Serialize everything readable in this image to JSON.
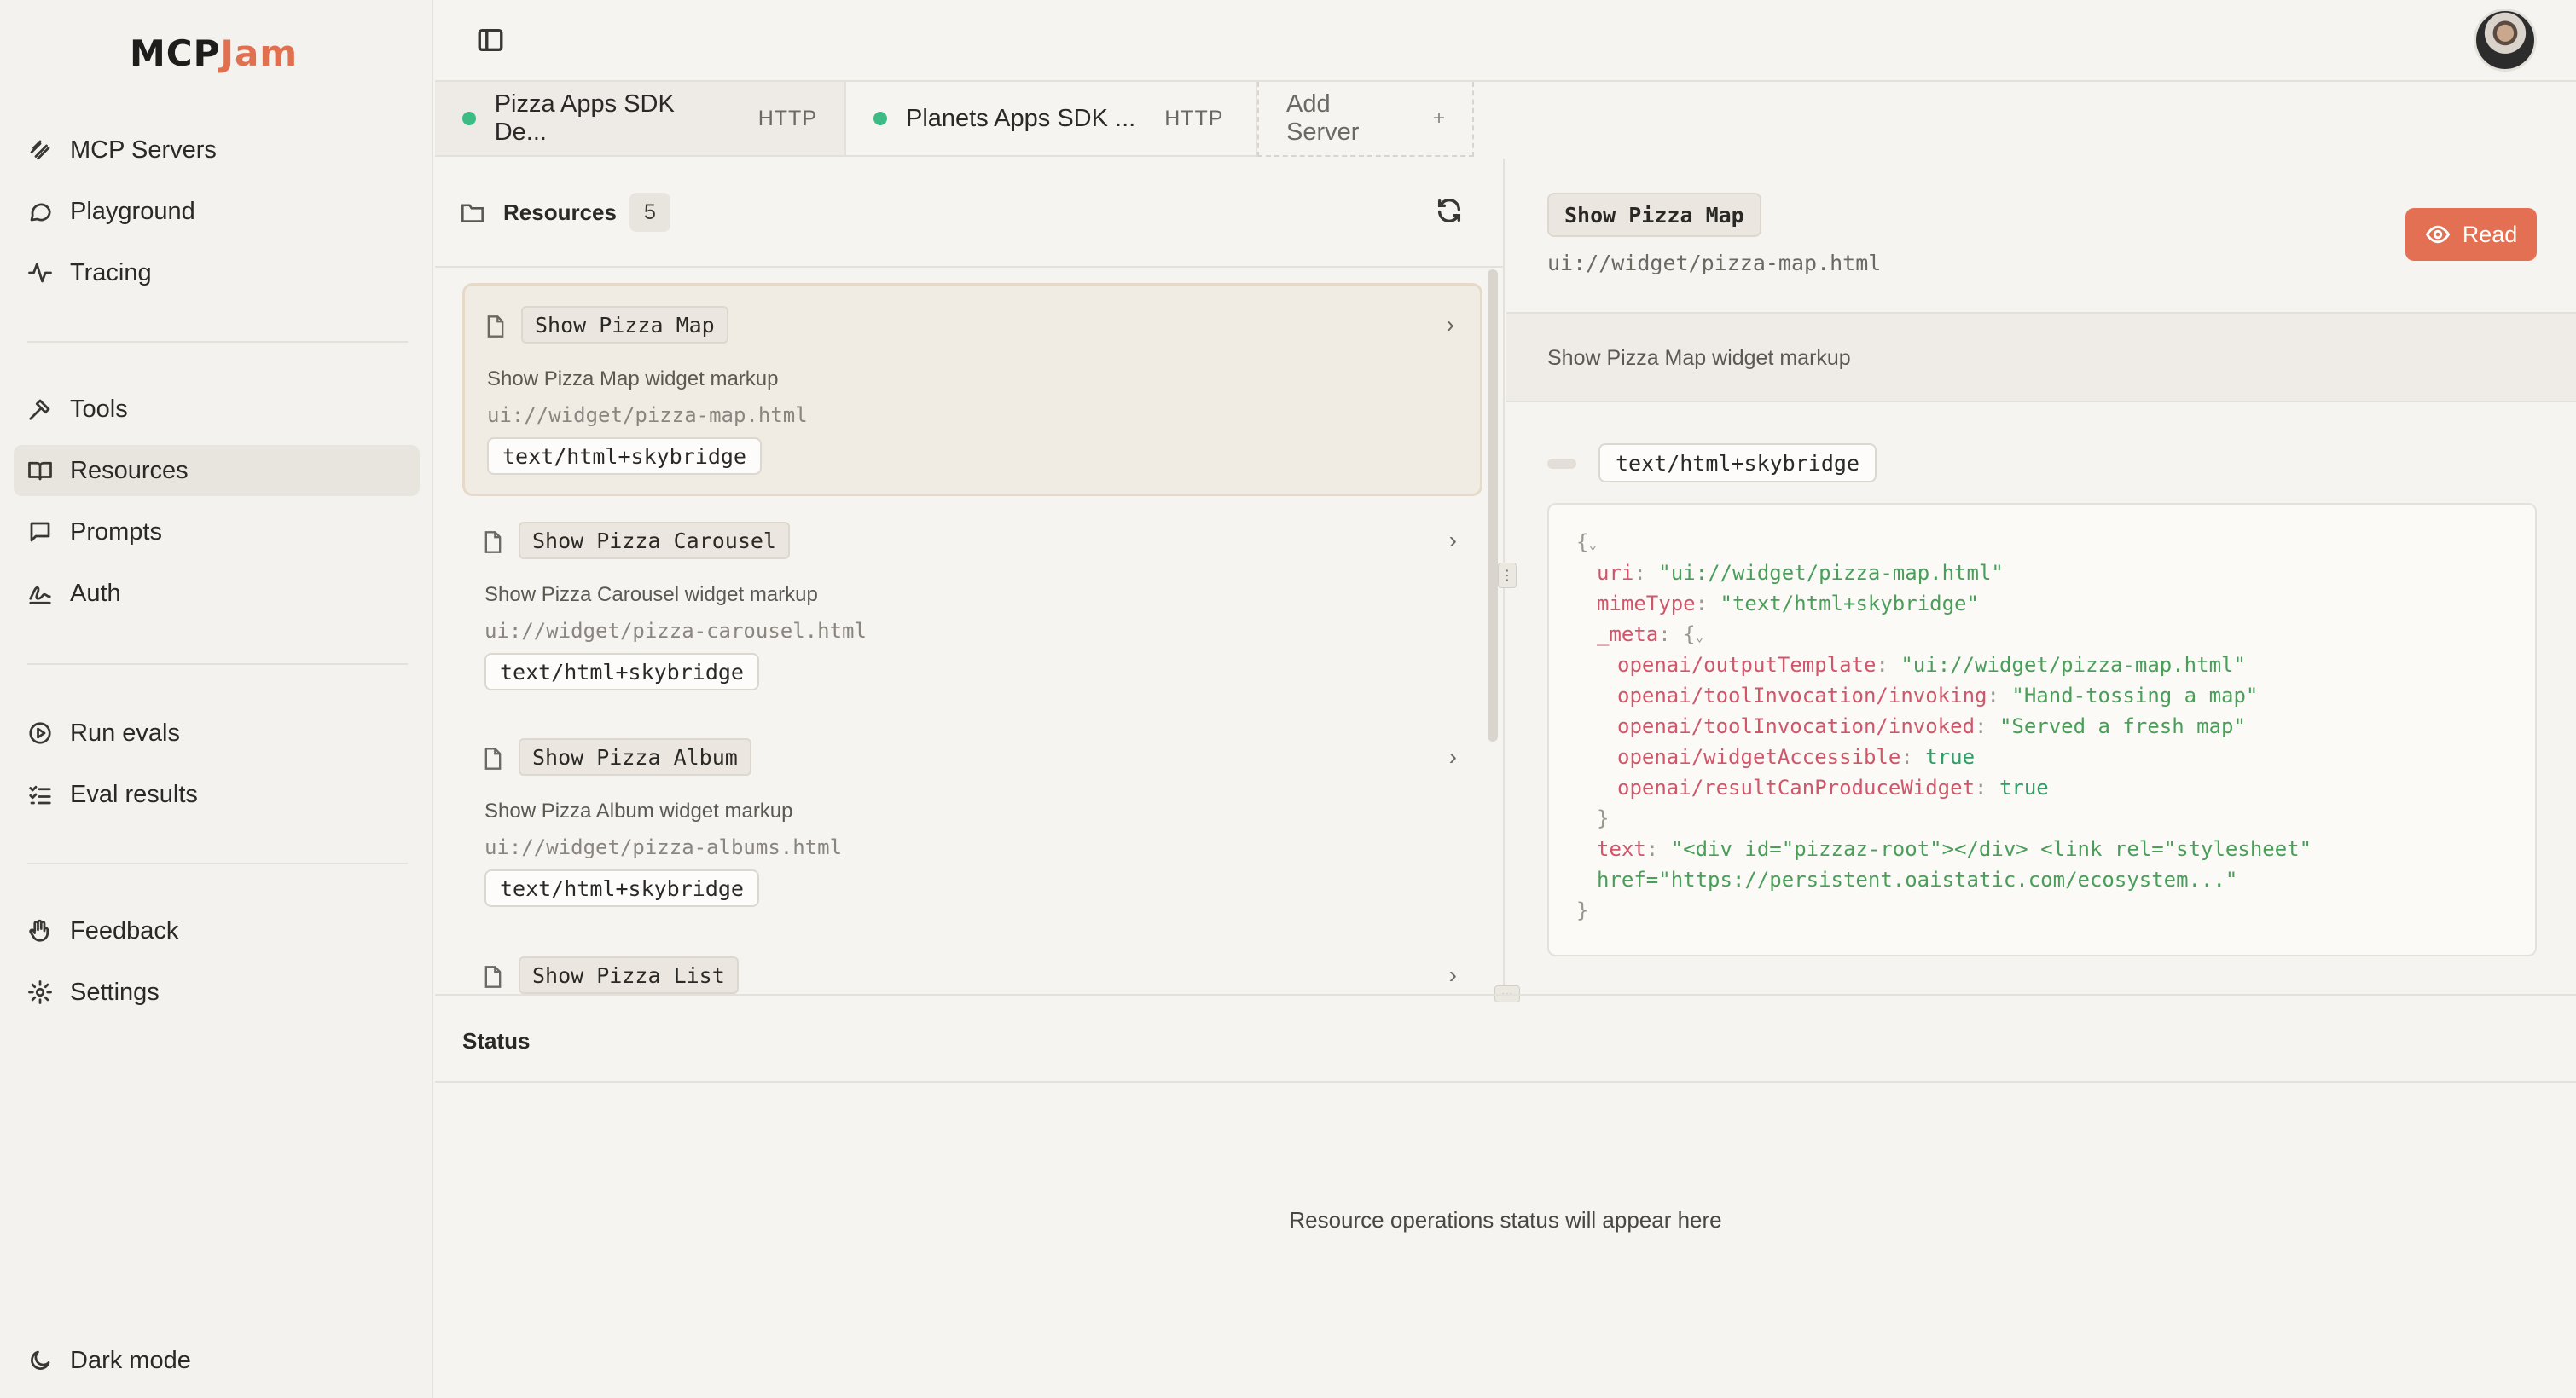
{
  "app": {
    "logo_part1": "MCP",
    "logo_part2": "Jam"
  },
  "sidebar": {
    "items": [
      {
        "label": "MCP Servers",
        "icon": "servers-icon"
      },
      {
        "label": "Playground",
        "icon": "chat-bubble-icon"
      },
      {
        "label": "Tracing",
        "icon": "activity-icon"
      },
      {
        "label": "Tools",
        "icon": "hammer-icon"
      },
      {
        "label": "Resources",
        "icon": "book-icon",
        "active": true
      },
      {
        "label": "Prompts",
        "icon": "message-square-icon"
      },
      {
        "label": "Auth",
        "icon": "signature-icon"
      },
      {
        "label": "Run evals",
        "icon": "play-circle-icon"
      },
      {
        "label": "Eval results",
        "icon": "list-checks-icon"
      },
      {
        "label": "Feedback",
        "icon": "hand-icon"
      },
      {
        "label": "Settings",
        "icon": "gear-icon"
      }
    ],
    "dark_mode_label": "Dark mode"
  },
  "server_tabs": [
    {
      "name": "Pizza Apps SDK De...",
      "protocol": "HTTP",
      "status_color": "#3dbb84",
      "active": true
    },
    {
      "name": "Planets Apps SDK ...",
      "protocol": "HTTP",
      "status_color": "#3dbb84",
      "active": false
    }
  ],
  "add_server_label": "Add Server",
  "add_server_plus": "+",
  "resources": {
    "title": "Resources",
    "count": "5",
    "items": [
      {
        "name": "Show Pizza Map",
        "description": "Show Pizza Map widget markup",
        "uri": "ui://widget/pizza-map.html",
        "mime": "text/html+skybridge"
      },
      {
        "name": "Show Pizza Carousel",
        "description": "Show Pizza Carousel widget markup",
        "uri": "ui://widget/pizza-carousel.html",
        "mime": "text/html+skybridge"
      },
      {
        "name": "Show Pizza Album",
        "description": "Show Pizza Album widget markup",
        "uri": "ui://widget/pizza-albums.html",
        "mime": "text/html+skybridge"
      },
      {
        "name": "Show Pizza List",
        "description": "",
        "uri": "",
        "mime": ""
      }
    ]
  },
  "detail": {
    "title": "Show Pizza Map",
    "uri": "ui://widget/pizza-map.html",
    "read_label": "Read",
    "description": "Show Pizza Map widget markup",
    "mime": "text/html+skybridge",
    "json": {
      "uri_key": "uri",
      "uri_val": "\"ui://widget/pizza-map.html\"",
      "mime_key": "mimeType",
      "mime_val": "\"text/html+skybridge\"",
      "meta_key": "_meta",
      "output_key": "openai/outputTemplate",
      "output_val": "\"ui://widget/pizza-map.html\"",
      "invoking_key": "openai/toolInvocation/invoking",
      "invoking_val": "\"Hand-tossing a map\"",
      "invoked_key": "openai/toolInvocation/invoked",
      "invoked_val": "\"Served a fresh map\"",
      "accessible_key": "openai/widgetAccessible",
      "accessible_val": "true",
      "canproduce_key": "openai/resultCanProduceWidget",
      "canproduce_val": "true",
      "text_key": "text",
      "text_val_1": "\"<div id=\"pizzaz-root\"></div> <link rel=\"stylesheet\"",
      "text_val_2": "href=\"https://persistent.oaistatic.com/ecosystem...\""
    }
  },
  "status": {
    "title": "Status",
    "message": "Resource operations status will appear here"
  },
  "colors": {
    "accent": "#e37052",
    "connected": "#3dbb84"
  }
}
